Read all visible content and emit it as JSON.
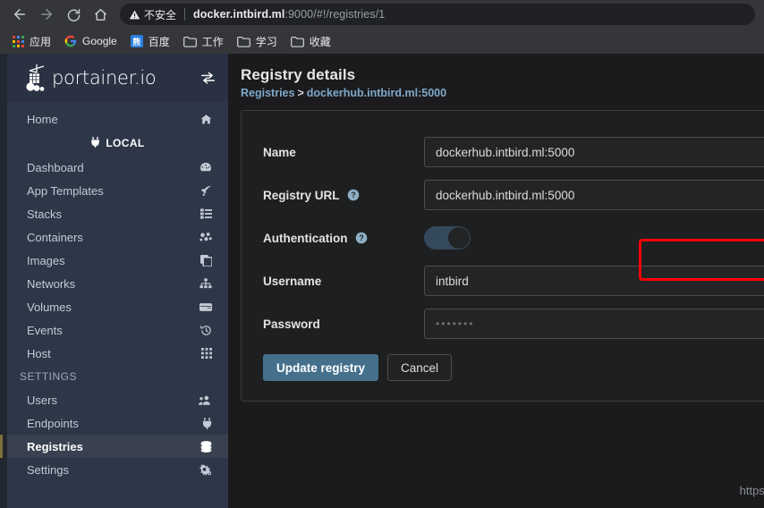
{
  "browser": {
    "nav": {
      "back_icon": "back-arrow-icon",
      "forward_icon": "forward-arrow-icon",
      "reload_icon": "reload-icon",
      "home_icon": "home-icon"
    },
    "omnibox": {
      "security_label": "不安全",
      "security_icon": "warning-triangle-icon",
      "url_host": "docker.intbird.ml",
      "url_rest": ":9000/#!/registries/1",
      "full_url": "docker.intbird.ml:9000/#!/registries/1"
    },
    "bookmarks": [
      {
        "label": "应用",
        "icon": "apps-grid-icon"
      },
      {
        "label": "Google",
        "icon": "google-icon"
      },
      {
        "label": "百度",
        "icon": "baidu-icon"
      },
      {
        "label": "工作",
        "icon": "folder-icon"
      },
      {
        "label": "学习",
        "icon": "folder-icon"
      },
      {
        "label": "收藏",
        "icon": "folder-icon"
      }
    ]
  },
  "sidebar": {
    "brand": "portainer.io",
    "brand_icon": "portainer-logo-icon",
    "swap_icon": "swap-arrows-icon",
    "home": {
      "label": "Home",
      "icon": "house-icon"
    },
    "endpoint": {
      "label": "LOCAL",
      "icon": "plug-icon"
    },
    "items": [
      {
        "label": "Dashboard",
        "icon": "gauge-icon",
        "active": false
      },
      {
        "label": "App Templates",
        "icon": "rocket-icon",
        "active": false
      },
      {
        "label": "Stacks",
        "icon": "list-icon",
        "active": false
      },
      {
        "label": "Containers",
        "icon": "containers-icon",
        "active": false
      },
      {
        "label": "Images",
        "icon": "images-icon",
        "active": false
      },
      {
        "label": "Networks",
        "icon": "network-icon",
        "active": false
      },
      {
        "label": "Volumes",
        "icon": "hdd-icon",
        "active": false
      },
      {
        "label": "Events",
        "icon": "history-icon",
        "active": false
      },
      {
        "label": "Host",
        "icon": "grid-icon",
        "active": false
      }
    ],
    "settings_header": "SETTINGS",
    "settings_items": [
      {
        "label": "Users",
        "icon": "users-icon",
        "active": false
      },
      {
        "label": "Endpoints",
        "icon": "plug-icon",
        "active": false
      },
      {
        "label": "Registries",
        "icon": "database-icon",
        "active": true
      },
      {
        "label": "Settings",
        "icon": "gears-icon",
        "active": false
      }
    ],
    "accent_color": "#7c7239"
  },
  "main": {
    "title": "Registry details",
    "breadcrumb": {
      "root": "Registries",
      "separator": ">",
      "current": "dockerhub.intbird.ml:5000"
    },
    "form": {
      "name": {
        "label": "Name",
        "value": "dockerhub.intbird.ml:5000",
        "placeholder": ""
      },
      "registry_url": {
        "label": "Registry URL",
        "help_icon": "help-circle-icon",
        "value": "dockerhub.intbird.ml:5000",
        "placeholder": "",
        "highlighted": true
      },
      "authentication": {
        "label": "Authentication",
        "help_icon": "help-circle-icon",
        "toggle_state": "off"
      },
      "username": {
        "label": "Username",
        "value": "intbird",
        "placeholder": ""
      },
      "password": {
        "label": "Password",
        "value": "•••••••",
        "placeholder": ""
      }
    },
    "buttons": {
      "submit": "Update registry",
      "cancel": "Cancel"
    },
    "highlight_color": "#fb0007"
  },
  "watermark": "https://blog.csdn.net/intbird"
}
